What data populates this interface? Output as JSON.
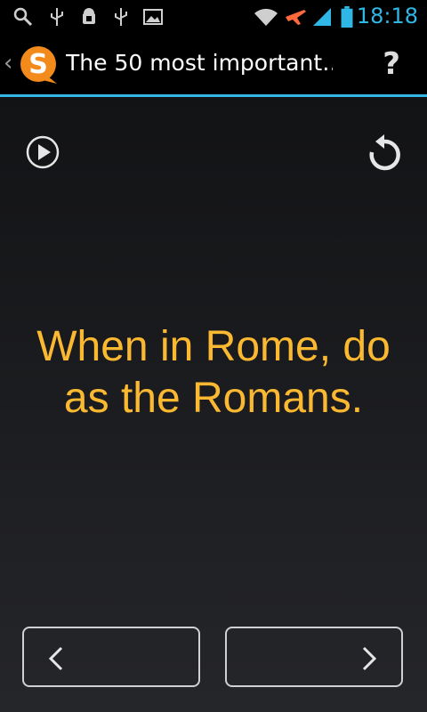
{
  "status_bar": {
    "time": "18:18",
    "icons": [
      "search-icon",
      "usb-icon",
      "android-debug-icon",
      "usb-icon",
      "image-icon",
      "wifi-icon",
      "airplane-icon",
      "signal-icon",
      "battery-icon"
    ],
    "accent": "#2fb8e6"
  },
  "action_bar": {
    "title": "The 50 most important…",
    "help": "?",
    "underline_color": "#33b5e5"
  },
  "card": {
    "phrase": "When in Rome, do as the Romans.",
    "phrase_color": "#fbb931"
  },
  "nav": {
    "prev_icon": "chevron-left-icon",
    "next_icon": "chevron-right-icon"
  }
}
